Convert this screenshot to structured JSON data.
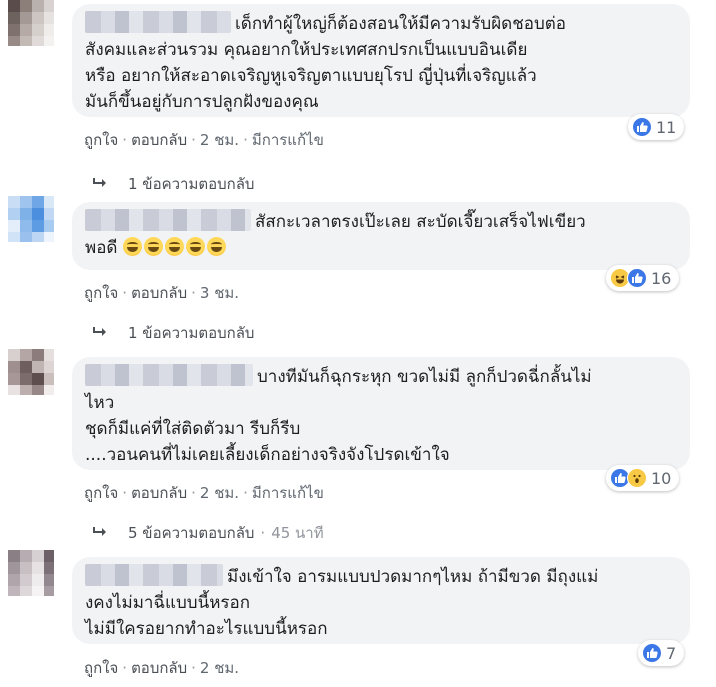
{
  "colors": {
    "bubble": "#f2f3f5",
    "like": "#3b77e6",
    "muted": "#606770",
    "emoji": "#f7c945"
  },
  "comments": [
    {
      "avatar_colors": [
        "#5a4c4a",
        "#8c7f7a",
        "#b9b1ad",
        "#d8d3d0",
        "#6e625e",
        "#a59995",
        "#ccc5c1",
        "#e6e2df",
        "#7f726e",
        "#b5aaa6",
        "#d6d0cd",
        "#efecea",
        "#988b87",
        "#c3bab6",
        "#e0dbd8",
        "#f4f2f0"
      ],
      "text": "เด็กทำผู้ใหญ่ก็ต้องสอนให้มีความรับผิดชอบต่อ\nสังคมและส่วนรวม คุณอยากให้ประเทศสกปรกเป็นแบบอินเดีย\nหรือ อยากให้สะอาดเจริญหูเจริญตาแบบยุโรป ญี่ปุ่นที่เจริญแล้ว\nมันก็ขึ้นอยู่กับการปลูกฝังของคุณ",
      "reactions": {
        "icons": [
          "like-icon"
        ],
        "count": "11"
      },
      "actions": {
        "like": "ถูกใจ",
        "reply": "ตอบกลับ",
        "time": "2 ชม.",
        "edited": "มีการแก้ไข"
      },
      "replies": {
        "label": "1 ข้อความตอบกลับ",
        "time": ""
      }
    },
    {
      "avatar_colors": [
        "#c9def4",
        "#9fc4ee",
        "#6ea6e6",
        "#d9e8f7",
        "#b1d0f2",
        "#7fb1e9",
        "#4d8fdf",
        "#c0d8f4",
        "#e3eefa",
        "#8ebbec",
        "#5d9be3",
        "#a8cbf0",
        "#d1e3f6",
        "#9ac1ed",
        "#bcd6f3",
        "#edf4fc"
      ],
      "text": "สัสกะเวลาตรงเป๊ะเลย สะบัดเจี๊ยวเสร็จไฟเขียว\nพอดี ",
      "emoji_count": 5,
      "reactions": {
        "icons": [
          "haha-icon",
          "like-icon"
        ],
        "count": "16"
      },
      "actions": {
        "like": "ถูกใจ",
        "reply": "ตอบกลับ",
        "time": "3 ชม.",
        "edited": ""
      },
      "replies": {
        "label": "1 ข้อความตอบกลับ",
        "time": ""
      }
    },
    {
      "avatar_colors": [
        "#d7d0cf",
        "#b3a6a5",
        "#8c7c7c",
        "#e5dfde",
        "#9f8f8f",
        "#6f5e5e",
        "#c1b5b4",
        "#ddd5d4",
        "#a79897",
        "#7d6c6c",
        "#5e4e4e",
        "#cbbfbe",
        "#e8e3e2",
        "#bcafae",
        "#978786",
        "#f1eded"
      ],
      "text": "บางทีมันก็ฉุกระหุก ขวดไม่มี ลูกก็ปวดฉี่กลั้นไม่\nไหว\nชุดก็มีแค่ที่ใส่ติดตัวมา รีบก็รีบ\n....วอนคนที่ไม่เคยเลี้ยงเด็กอย่างจริงจังโปรดเข้าใจ",
      "reactions": {
        "icons": [
          "like-icon",
          "wow-icon"
        ],
        "count": "10"
      },
      "actions": {
        "like": "ถูกใจ",
        "reply": "ตอบกลับ",
        "time": "2 ชม.",
        "edited": "มีการแก้ไข"
      },
      "replies": {
        "label": "5 ข้อความตอบกลับ",
        "time": "45 นาที"
      }
    },
    {
      "avatar_colors": [
        "#8a7f85",
        "#b6acb1",
        "#d7d0d3",
        "#6c6066",
        "#a0959b",
        "#c8bfc3",
        "#e6e1e3",
        "#7d7177",
        "#b0a5ab",
        "#d2cace",
        "#efecee",
        "#938890",
        "#bfb5ba",
        "#ddd7da",
        "#f5f3f4",
        "#a69ca1"
      ],
      "text": "มึงเข้าใจ อารมแบบปวดมากๆไหม ถ้ามีขวด มีถุงแม่\nงคงไม่มาฉี่แบบนี้หรอก\nไม่มีใครอยากทำอะไรแบบนี้หรอก",
      "reactions": {
        "icons": [
          "like-icon"
        ],
        "count": "7"
      },
      "actions": {
        "like": "ถูกใจ",
        "reply": "ตอบกลับ",
        "time": "2 ชม.",
        "edited": ""
      },
      "replies": null
    }
  ]
}
